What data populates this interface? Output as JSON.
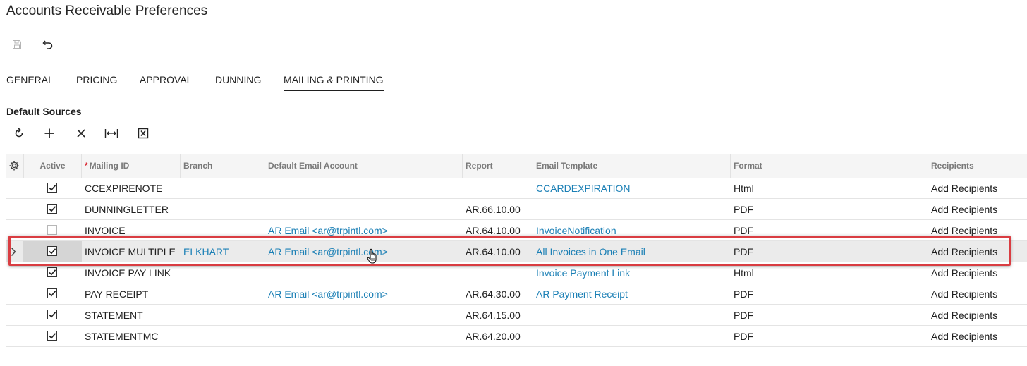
{
  "title": "Accounts Receivable Preferences",
  "toolbar": {
    "save_icon": "save-icon",
    "undo_icon": "undo-icon"
  },
  "tabs": [
    {
      "label": "GENERAL",
      "active": false
    },
    {
      "label": "PRICING",
      "active": false
    },
    {
      "label": "APPROVAL",
      "active": false
    },
    {
      "label": "DUNNING",
      "active": false
    },
    {
      "label": "MAILING & PRINTING",
      "active": true
    }
  ],
  "section": {
    "title": "Default Sources",
    "toolbar_icons": [
      "refresh-icon",
      "add-row-icon",
      "delete-row-icon",
      "fit-columns-icon",
      "export-excel-icon"
    ]
  },
  "grid": {
    "columns": [
      "",
      "Active",
      "Mailing ID",
      "Branch",
      "Default Email Account",
      "Report",
      "Email Template",
      "Format",
      "Recipients"
    ],
    "required_mark": "*",
    "rows": [
      {
        "active": true,
        "mailing_id": "CCEXPIRENOTE",
        "branch": "",
        "email_account": "",
        "report": "",
        "template": "CCARDEXPIRATION",
        "format": "Html",
        "recipients": "Add Recipients"
      },
      {
        "active": true,
        "mailing_id": "DUNNINGLETTER",
        "branch": "",
        "email_account": "",
        "report": "AR.66.10.00",
        "template": "",
        "format": "PDF",
        "recipients": "Add Recipients"
      },
      {
        "active": false,
        "mailing_id": "INVOICE",
        "branch": "",
        "email_account": "AR Email <ar@trpintl.com>",
        "report": "AR.64.10.00",
        "template": "InvoiceNotification",
        "format": "PDF",
        "recipients": "Add Recipients"
      },
      {
        "active": true,
        "mailing_id": "INVOICE MULTIPLE",
        "branch": "ELKHART",
        "email_account": "AR Email <ar@trpintl.com>",
        "report": "AR.64.10.00",
        "template": "All Invoices in One Email",
        "format": "PDF",
        "recipients": "Add Recipients",
        "selected": true
      },
      {
        "active": true,
        "mailing_id": "INVOICE PAY LINK",
        "branch": "",
        "email_account": "",
        "report": "",
        "template": "Invoice Payment Link",
        "format": "Html",
        "recipients": "Add Recipients"
      },
      {
        "active": true,
        "mailing_id": "PAY RECEIPT",
        "branch": "",
        "email_account": "AR Email <ar@trpintl.com>",
        "report": "AR.64.30.00",
        "template": "AR Payment Receipt",
        "format": "PDF",
        "recipients": "Add Recipients"
      },
      {
        "active": true,
        "mailing_id": "STATEMENT",
        "branch": "",
        "email_account": "",
        "report": "AR.64.15.00",
        "template": "",
        "format": "PDF",
        "recipients": "Add Recipients"
      },
      {
        "active": true,
        "mailing_id": "STATEMENTMC",
        "branch": "",
        "email_account": "",
        "report": "AR.64.20.00",
        "template": "",
        "format": "PDF",
        "recipients": "Add Recipients"
      }
    ]
  },
  "colors": {
    "link": "#1a7fb5",
    "highlight_border": "#d93d42",
    "selected_row": "#ebebeb"
  }
}
